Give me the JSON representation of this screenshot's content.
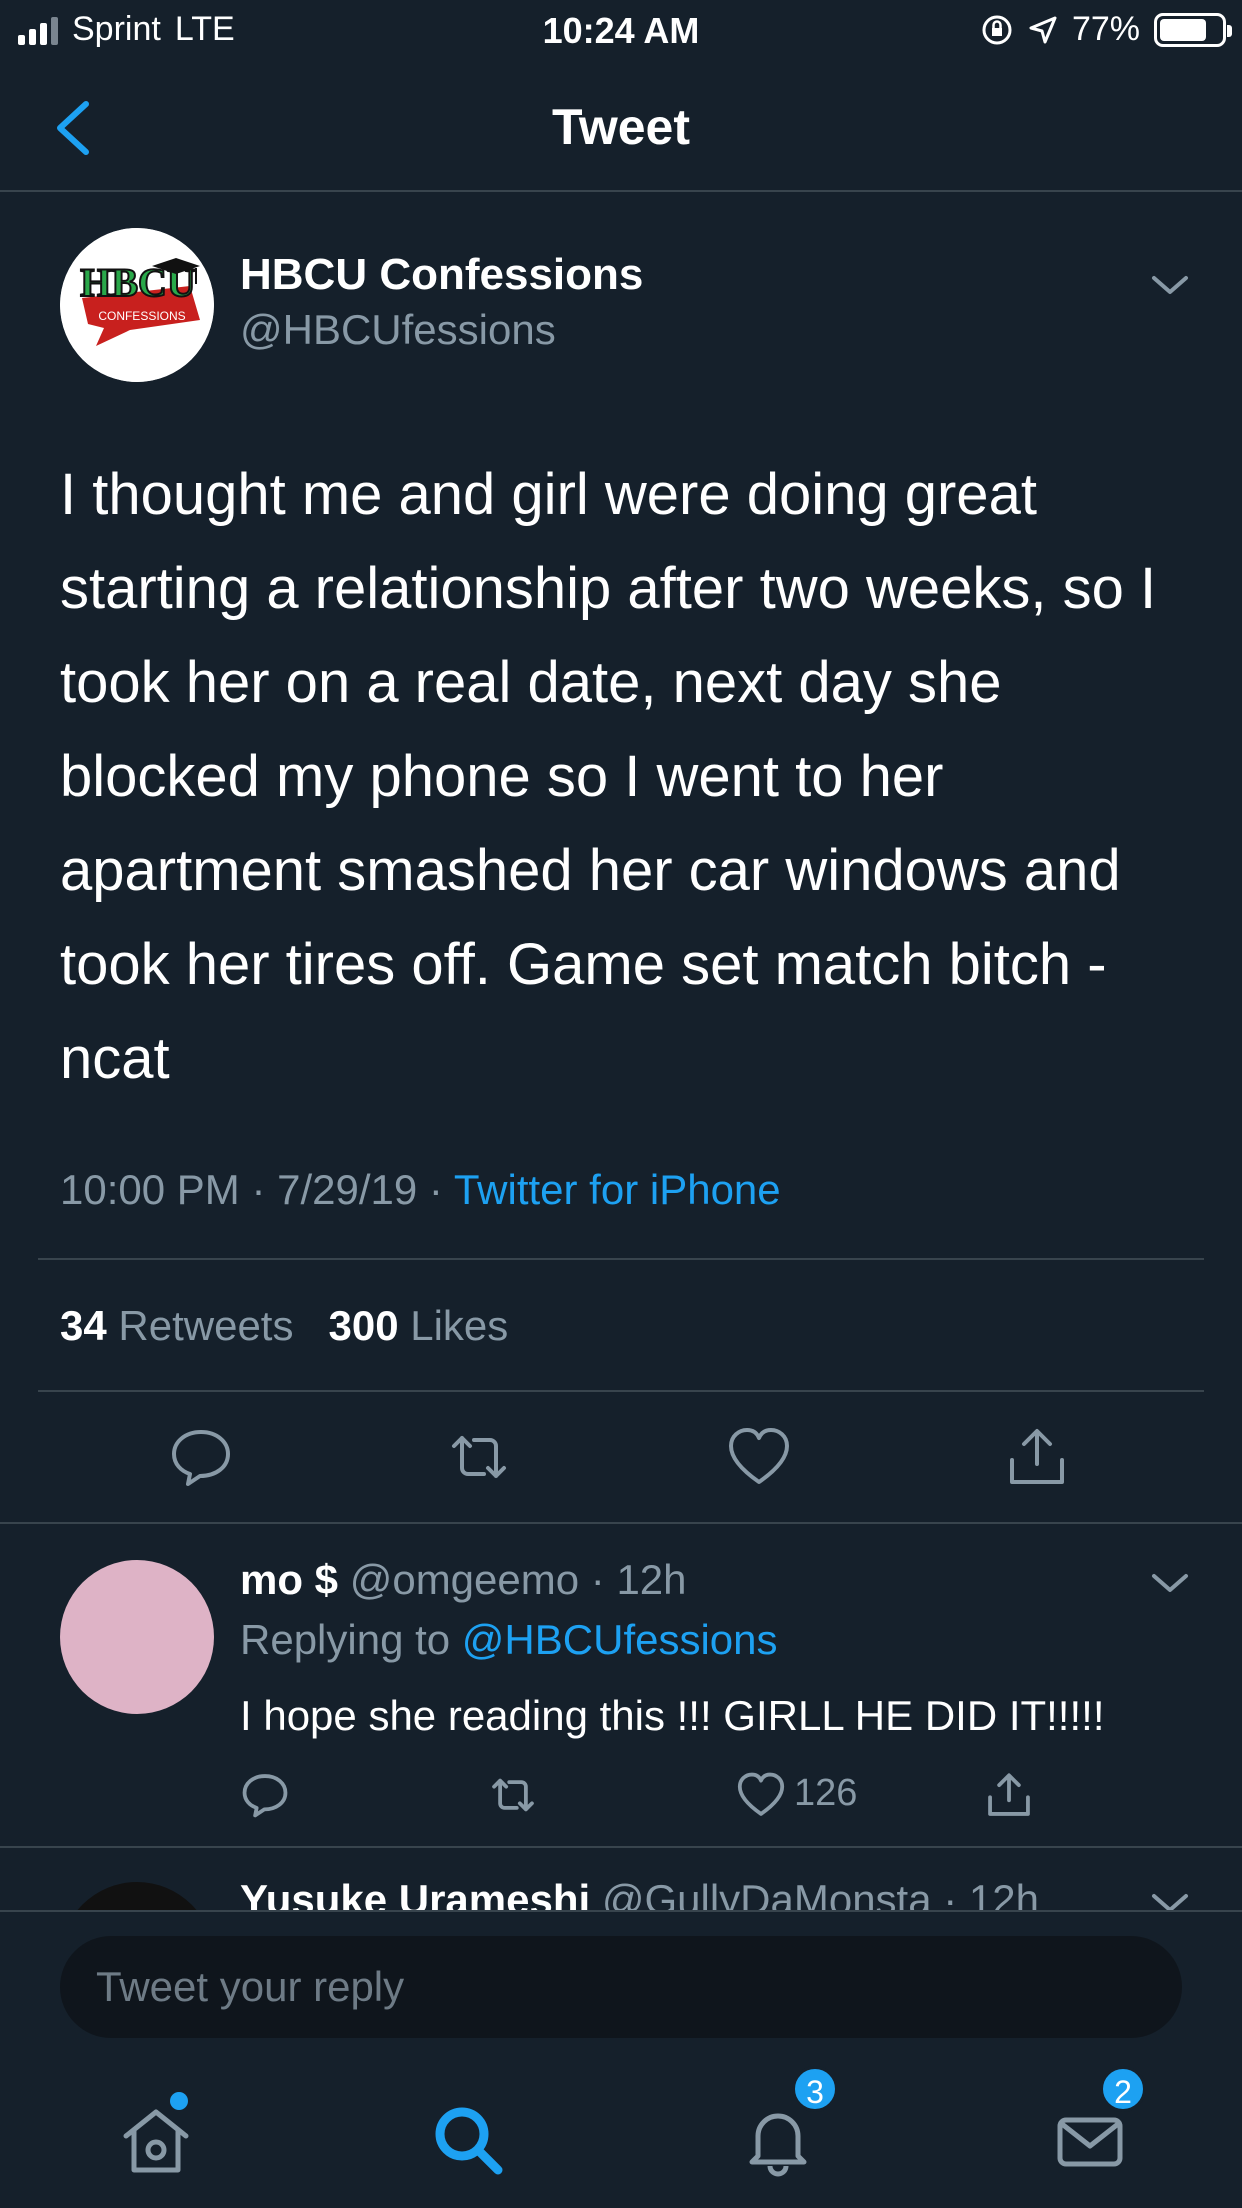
{
  "status_bar": {
    "carrier": "Sprint",
    "network": "LTE",
    "time": "10:24 AM",
    "battery": "77%",
    "battery_level": 0.77
  },
  "nav": {
    "title": "Tweet"
  },
  "tweet": {
    "author_name": "HBCU Confessions",
    "author_handle": "@HBCUfessions",
    "avatar_text": "HBCU",
    "avatar_subtext": "CONFESSIONS",
    "text": "I thought me and girl were doing great starting a relationship after two weeks, so I took her on a real date, next day she blocked my phone so I went to her apartment smashed her car windows and took her tires off. Game set match bitch - ncat",
    "time": "10:00 PM",
    "date": "7/29/19",
    "source": "Twitter for iPhone",
    "retweets_count": "34",
    "retweets_label": "Retweets",
    "likes_count": "300",
    "likes_label": "Likes"
  },
  "replies": [
    {
      "name": "mo $",
      "handle": "@omgeemo",
      "time": "12h",
      "replying_to_label": "Replying to",
      "replying_to": "@HBCUfessions",
      "text": "I hope she reading this !!! GIRLL HE DID IT!!!!!",
      "likes": "126"
    },
    {
      "name": "Yusuke Urameshi",
      "handle": "@GullyDaMonsta",
      "time": "12h"
    }
  ],
  "compose": {
    "placeholder": "Tweet your reply"
  },
  "tab_bar": {
    "notifications_badge": "3",
    "messages_badge": "2"
  },
  "colors": {
    "accent": "#1da1f2",
    "background": "#15202b",
    "muted": "#8899a6"
  }
}
